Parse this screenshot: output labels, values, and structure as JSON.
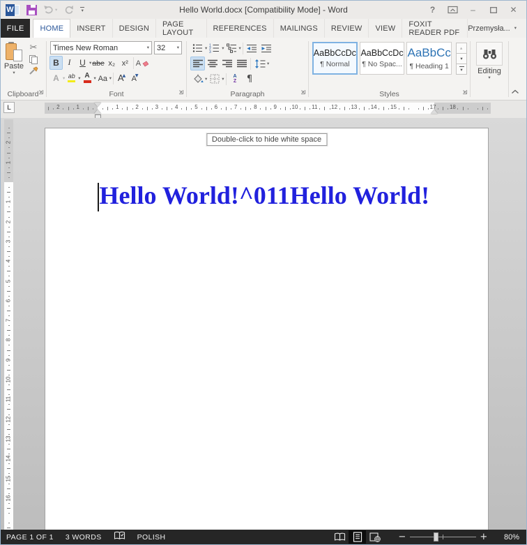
{
  "icons": {
    "caret": "▾",
    "scissors": "✂",
    "pilcrow": "¶",
    "help": "?",
    "close": "✕",
    "minimize": "–",
    "up_small": "▲",
    "down_small": "▼",
    "sort_a": "A",
    "sort_z": "Z",
    "tab_l": "L"
  },
  "titlebar": {
    "title": "Hello World.docx [Compatibility Mode] - Word"
  },
  "tabs": {
    "file": "FILE",
    "items": [
      "HOME",
      "INSERT",
      "DESIGN",
      "PAGE LAYOUT",
      "REFERENCES",
      "MAILINGS",
      "REVIEW",
      "VIEW",
      "FOXIT READER PDF"
    ],
    "active": "HOME",
    "user": "Przemysła..."
  },
  "clipboard": {
    "group": "Clipboard",
    "paste": "Paste"
  },
  "font": {
    "group": "Font",
    "name": "Times New Roman",
    "size": "32",
    "bold": "B",
    "italic": "I",
    "underline": "U",
    "strike": "abe",
    "subscript": "x₂",
    "superscript": "x²",
    "clear": "A",
    "effects": "A",
    "highlight": "ab",
    "color": "A",
    "case": "Aa",
    "grow": "A",
    "shrink": "A"
  },
  "paragraph": {
    "group": "Paragraph"
  },
  "styles": {
    "group": "Styles",
    "items": [
      {
        "preview": "AaBbCcDc",
        "name": "¶ Normal"
      },
      {
        "preview": "AaBbCcDc",
        "name": "¶ No Spac..."
      },
      {
        "preview": "AaBbCc",
        "name": "¶ Heading 1"
      }
    ]
  },
  "editing": {
    "group": "Editing",
    "label": "Editing"
  },
  "rulers": {
    "h": {
      "cm": 28.3,
      "zero": 76,
      "len": 640,
      "qmin": -10,
      "qmax": 79,
      "labels": {
        "-2": "2",
        "-1": "1",
        "1": "1",
        "2": "2",
        "3": "3",
        "4": "4",
        "5": "5",
        "6": "6",
        "7": "7",
        "8": "8",
        "9": "9",
        "10": "10",
        "11": "11",
        "12": "12",
        "13": "13",
        "14": "14",
        "15": "15",
        "17": "17",
        "18": "18"
      }
    },
    "v": {
      "cm": 28.3,
      "zero": 90,
      "len": 588,
      "qmin": -12,
      "qmax": 70,
      "labels": {
        "-2": "2",
        "-1": "1",
        "1": "1",
        "2": "2",
        "3": "3",
        "4": "4",
        "5": "5",
        "6": "6",
        "7": "7",
        "8": "8",
        "9": "9",
        "10": "10",
        "11": "11",
        "12": "12",
        "13": "13",
        "14": "14",
        "15": "15",
        "16": "16"
      }
    }
  },
  "document": {
    "tooltip": "Double-click to hide white space",
    "text": "Hello World!^011Hello World!"
  },
  "status": {
    "page": "PAGE 1 OF 1",
    "words": "3 WORDS",
    "language": "POLISH",
    "zoom_level": "80%"
  }
}
